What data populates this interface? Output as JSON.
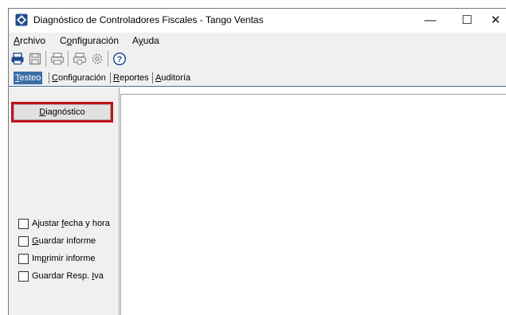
{
  "window": {
    "title": "Diagnóstico de Controladores Fiscales - Tango Ventas",
    "minimize": "—",
    "maximize": "☐",
    "close": "✕",
    "app_icon": "diamond-app-icon",
    "accent": "#3a6ea5"
  },
  "menu": {
    "archivo": {
      "u": "A",
      "rest": "rchivo"
    },
    "configuracion": {
      "pre": "C",
      "u": "o",
      "rest": "nfiguración"
    },
    "ayuda": {
      "pre": "A",
      "u": "y",
      "rest": "uda"
    }
  },
  "toolbar": {
    "icons": [
      "printer-icon",
      "save-icon",
      "printer-icon",
      "printer-setup-icon",
      "settings-icon",
      "help-icon"
    ]
  },
  "tabs": {
    "testeo": {
      "u": "T",
      "rest": "esteo"
    },
    "configuracion": {
      "u": "C",
      "rest": "onfiguración"
    },
    "reportes": {
      "u": "R",
      "rest": "eportes"
    },
    "auditoria": {
      "u": "A",
      "rest": "uditoría"
    }
  },
  "left": {
    "diagnostico": {
      "u": "D",
      "rest": "iagnóstico"
    },
    "highlight_color": "#c0141b",
    "checks": {
      "ajustar": {
        "pre": "Ajustar ",
        "u": "f",
        "rest": "echa y hora"
      },
      "guardar_informe": {
        "pre": "",
        "u": "G",
        "rest": "uardar informe"
      },
      "imprimir": {
        "pre": "Im",
        "u": "p",
        "rest": "rimir informe"
      },
      "guardar_resp": {
        "pre": "Guardar Resp. ",
        "u": "I",
        "rest": "va"
      }
    }
  }
}
